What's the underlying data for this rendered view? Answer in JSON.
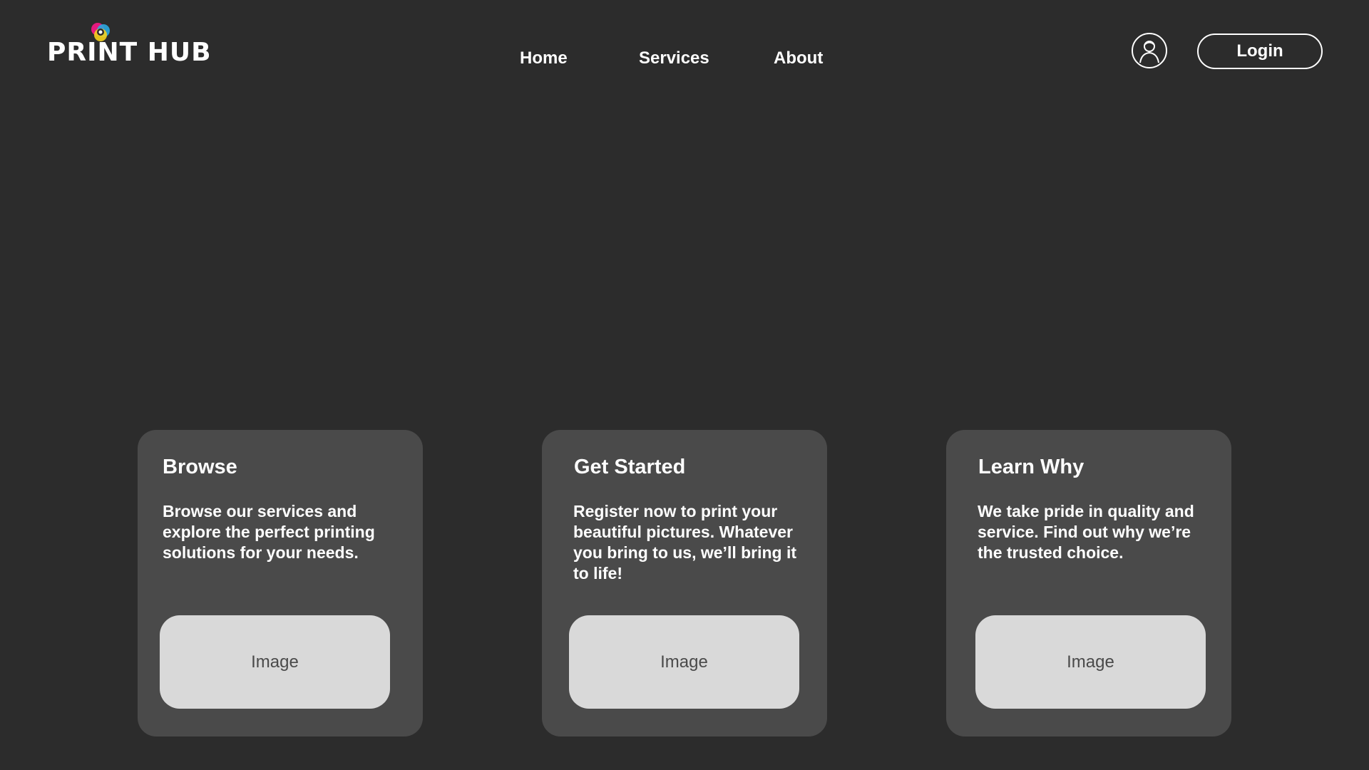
{
  "header": {
    "logo": {
      "text_first": "PRINT",
      "text_second": "HUB",
      "icon": "cmyk-swirl-icon",
      "colors": [
        "#2aa9e0",
        "#e5197e",
        "#f5d21d",
        "#222222"
      ]
    },
    "nav": [
      {
        "label": "Home"
      },
      {
        "label": "Services"
      },
      {
        "label": "About"
      }
    ],
    "user_icon": "user-icon",
    "login_label": "Login"
  },
  "cards": [
    {
      "title": "Browse",
      "description": "Browse our services and explore the perfect printing solutions for your needs.",
      "image_label": "Image"
    },
    {
      "title": "Get Started",
      "description": "Register now to print your beautiful pictures. Whatever you bring to us, we’ll bring it to life!",
      "image_label": "Image"
    },
    {
      "title": "Learn Why",
      "description": "We take pride in quality and service. Find out why we’re the trusted choice.",
      "image_label": "Image"
    }
  ],
  "colors": {
    "background": "#2c2c2c",
    "card": "#4a4a4a",
    "image_placeholder": "#d9d9d9",
    "text": "#ffffff"
  }
}
